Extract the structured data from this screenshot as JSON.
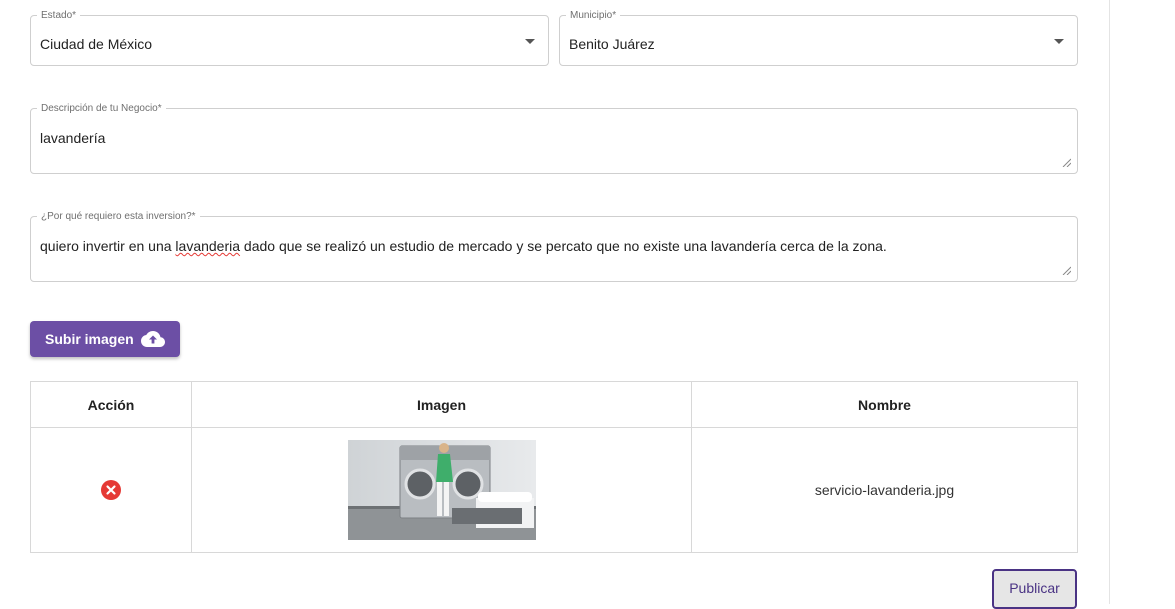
{
  "form": {
    "estado": {
      "label": "Estado*",
      "value": "Ciudad de México"
    },
    "municipio": {
      "label": "Municipio*",
      "value": "Benito Juárez"
    },
    "descripcion": {
      "label": "Descripción de tu Negocio*",
      "value": "lavandería"
    },
    "razon": {
      "label": "¿Por qué requiero esta inversion?*",
      "value_before": "quiero invertir en una ",
      "value_misspelled": "lavanderia",
      "value_after": " dado que se realizó un estudio de mercado y se percato que no existe una lavandería cerca de la zona."
    }
  },
  "upload_button": {
    "label": "Subir imagen",
    "icon": "cloud-upload-icon"
  },
  "table": {
    "headers": [
      "Acción",
      "Imagen",
      "Nombre"
    ],
    "rows": [
      {
        "action_icon": "delete-icon",
        "image_icon": "laundry-photo",
        "name": "servicio-lavanderia.jpg"
      }
    ]
  },
  "publish_button": {
    "label": "Publicar"
  },
  "colors": {
    "primary": "#6c4fa5",
    "delete": "#e53935",
    "publish_border": "#4a3384"
  }
}
